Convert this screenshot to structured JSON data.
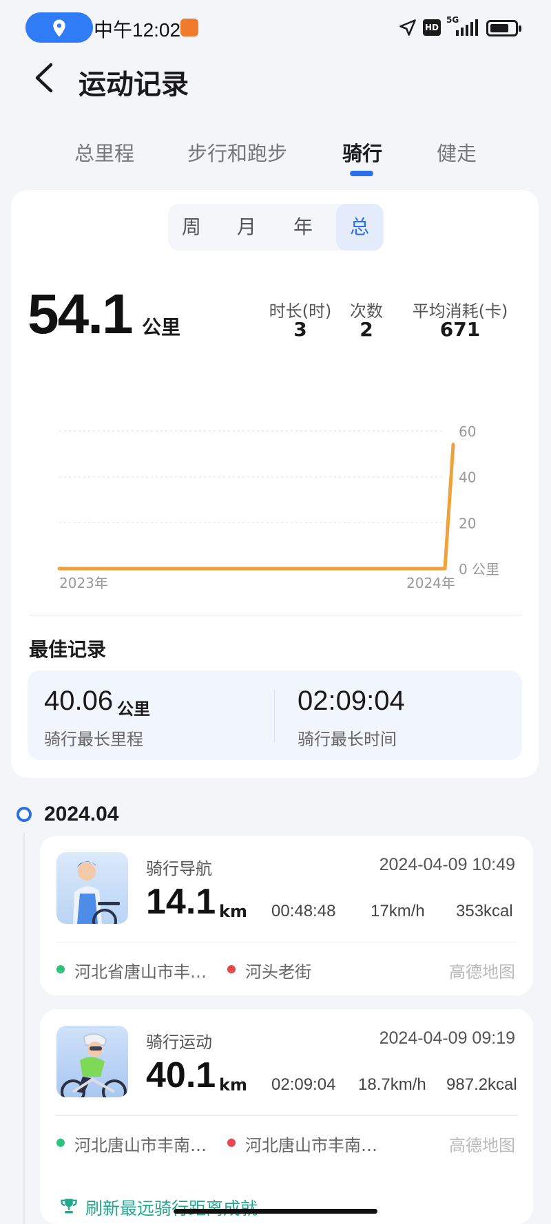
{
  "status_bar": {
    "time": "中午12:02",
    "network": "5G",
    "hd_label": "HD",
    "battery_level": 0.75,
    "icons": [
      "location-pin-icon",
      "app-notification-icon",
      "navigation-arrow-icon",
      "signal-icon",
      "battery-icon"
    ]
  },
  "header": {
    "title": "运动记录",
    "back_icon": "chevron-left-icon"
  },
  "tabs": [
    {
      "label": "总里程",
      "active": false
    },
    {
      "label": "步行和跑步",
      "active": false
    },
    {
      "label": "骑行",
      "active": true
    },
    {
      "label": "健走",
      "active": false
    }
  ],
  "period_selector": [
    {
      "label": "周",
      "active": false
    },
    {
      "label": "月",
      "active": false
    },
    {
      "label": "年",
      "active": false
    },
    {
      "label": "总",
      "active": true
    }
  ],
  "summary": {
    "total_distance": "54.1",
    "distance_unit": "公里",
    "stats": [
      {
        "label": "时长(时)",
        "value": "3"
      },
      {
        "label": "次数",
        "value": "2"
      },
      {
        "label": "平均消耗(卡)",
        "value": "671"
      }
    ]
  },
  "chart_data": {
    "type": "line",
    "x": [
      "2023年",
      "2024年"
    ],
    "series": [
      {
        "values": [
          0,
          0,
          54.1
        ]
      }
    ],
    "x_tick_labels": [
      "2023年",
      "2024年"
    ],
    "y_tick_labels": [
      "60",
      "40",
      "20",
      "0 公里"
    ],
    "ylim": [
      0,
      60
    ],
    "line_color": "#f0a23a",
    "grid": true
  },
  "best_records": {
    "title": "最佳记录",
    "items": [
      {
        "value": "40.06",
        "unit": "公里",
        "label": "骑行最长里程"
      },
      {
        "value": "02:09:04",
        "unit": "",
        "label": "骑行最长时间"
      }
    ]
  },
  "timeline": {
    "month": "2024.04",
    "activities": [
      {
        "type": "骑行导航",
        "datetime": "2024-04-09 10:49",
        "distance": "14.1",
        "distance_unit": "km",
        "duration": "00:48:48",
        "speed": "17km/h",
        "calories": "353kcal",
        "start": "河北省唐山市丰…",
        "end": "河头老街",
        "map_source": "高德地图",
        "start_color": "#2ec27e",
        "end_color": "#e5484d"
      },
      {
        "type": "骑行运动",
        "datetime": "2024-04-09 09:19",
        "distance": "40.1",
        "distance_unit": "km",
        "duration": "02:09:04",
        "speed": "18.7km/h",
        "calories": "987.2kcal",
        "start": "河北唐山市丰南…",
        "end": "河北唐山市丰南…",
        "map_source": "高德地图",
        "start_color": "#2ec27e",
        "end_color": "#e5484d",
        "achievement": "刷新最远骑行距离成就"
      }
    ]
  },
  "colors": {
    "accent": "#2a6fe8",
    "chart_line": "#f0a23a",
    "achievement": "#23a88f"
  }
}
